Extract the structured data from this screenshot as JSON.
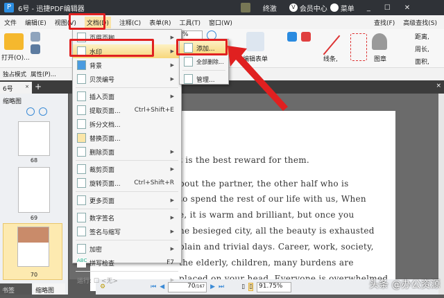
{
  "titlebar": {
    "title": "6号 - 迅捷PDF编辑器",
    "user": "终激",
    "member": "会员中心",
    "menu": "菜单"
  },
  "menubar": {
    "items": [
      "文件",
      "编辑(E)",
      "视图(V)",
      "文档(D)",
      "注释(C)",
      "表单(R)",
      "工具(T)",
      "窗口(W)"
    ],
    "find": "查找(F)",
    "advanced_find": "高级查找(S)"
  },
  "ribbon": {
    "open": "打开(O)...",
    "zoom_value": "%",
    "edit_form": "编辑表单",
    "lines": "线条,",
    "stamp": "图章",
    "distance": "距离,",
    "perimeter": "周长,",
    "area": "面积,"
  },
  "toolbar2": {
    "exclusive_mode": "独占模式",
    "properties": "属性(P)..."
  },
  "tabs": {
    "doc_tab": "6号"
  },
  "doc_menu": {
    "items": [
      {
        "label": "页眉页脚",
        "arrow": true
      },
      {
        "label": "水印",
        "arrow": true,
        "active": true
      },
      {
        "label": "背景",
        "arrow": true
      },
      {
        "label": "贝茨编号",
        "arrow": true
      },
      {
        "label": "插入页面",
        "arrow": true
      },
      {
        "label": "提取页面...",
        "shortcut": "Ctrl+Shift+E"
      },
      {
        "label": "拆分文档..."
      },
      {
        "label": "替换页面..."
      },
      {
        "label": "删除页面",
        "arrow": true
      },
      {
        "label": "裁剪页面",
        "arrow": true
      },
      {
        "label": "旋转页面...",
        "shortcut": "Ctrl+Shift+R"
      },
      {
        "label": "更多页面",
        "arrow": true
      },
      {
        "label": "数字签名",
        "arrow": true
      },
      {
        "label": "签名与缩写",
        "arrow": true
      },
      {
        "label": "加密",
        "arrow": true
      },
      {
        "label": "拼写检查",
        "shortcut": "F7"
      },
      {
        "label": "运行: ☐ <无>",
        "arrow": true,
        "disabled": true
      }
    ]
  },
  "watermark_submenu": {
    "items": [
      "添加...",
      "全部删除...",
      "管理..."
    ]
  },
  "left_panel": {
    "title": "缩略图",
    "thumbnails": [
      "68",
      "69",
      "70"
    ],
    "tabs": [
      "书签",
      "缩略图"
    ]
  },
  "document": {
    "lines": [
      "t is the best reward for them.",
      "bout  the  partner,  the  other  half  who  is",
      "  to spend the rest of our life with us, When",
      "e,  it  is  warm  and  brilliant,  but  once  you",
      "he besieged city, all the beauty is exhausted",
      "plain and trivial days. Career, work, society,",
      "  the  elderly,  children,  many  burdens  are",
      "placed  on  your  head.  Everyone  is  overwhelmed"
    ]
  },
  "status": {
    "page_current": "70",
    "page_total": "/167",
    "zoom": "91.75%"
  },
  "watermark_text": "头条 @办公资源",
  "colors": {
    "highlight": "#e02020",
    "menu_hover": "#f7d77b"
  }
}
